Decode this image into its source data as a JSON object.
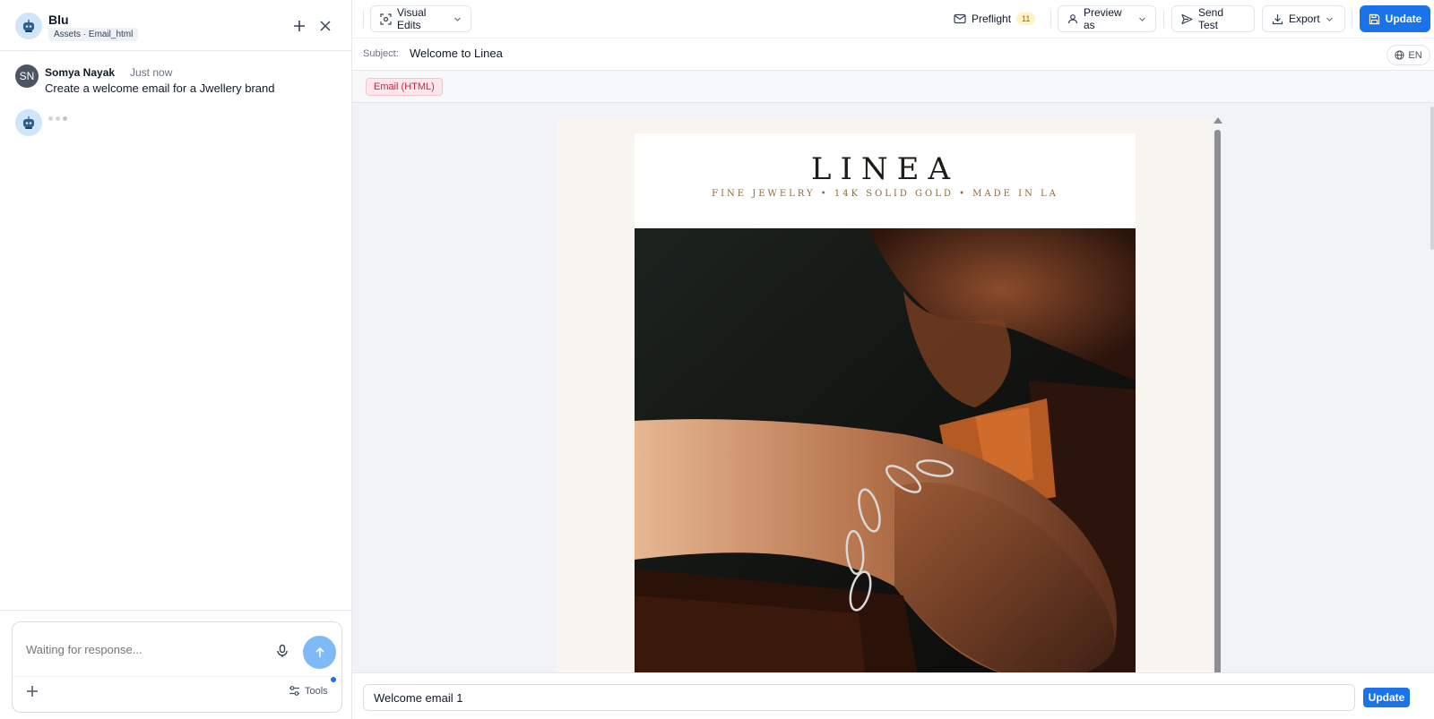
{
  "assistant": {
    "name": "Blu",
    "context_tag": "Assets · Email_html"
  },
  "chat": {
    "messages": [
      {
        "author": "Somya Nayak",
        "initials": "SN",
        "time": "Just now",
        "text": "Create a welcome email for a Jwellery brand"
      }
    ]
  },
  "composer": {
    "placeholder": "Waiting for response...",
    "tools_label": "Tools"
  },
  "toolbar": {
    "visual_edits_label": "Visual Edits",
    "preflight_label": "Preflight",
    "preflight_count": "11",
    "preview_label": "Preview as",
    "send_test_label": "Send Test",
    "export_label": "Export",
    "update_label": "Update"
  },
  "subject": {
    "label": "Subject:",
    "value": "Welcome to Linea",
    "language": "EN"
  },
  "format_tag": "Email (HTML)",
  "email": {
    "brand": "LINEA",
    "tagline": "FINE JEWELRY • 14K SOLID GOLD • MADE IN LA"
  },
  "footer": {
    "name_value": "Welcome email 1",
    "update_label": "Update"
  },
  "colors": {
    "accent": "#1a73e8",
    "send_button": "#7fbaf7",
    "tag_bg": "#fde7ec",
    "tag_text": "#c0264d",
    "email_bg": "#f8f5f1",
    "tagline_gold": "#8a6a3b"
  }
}
